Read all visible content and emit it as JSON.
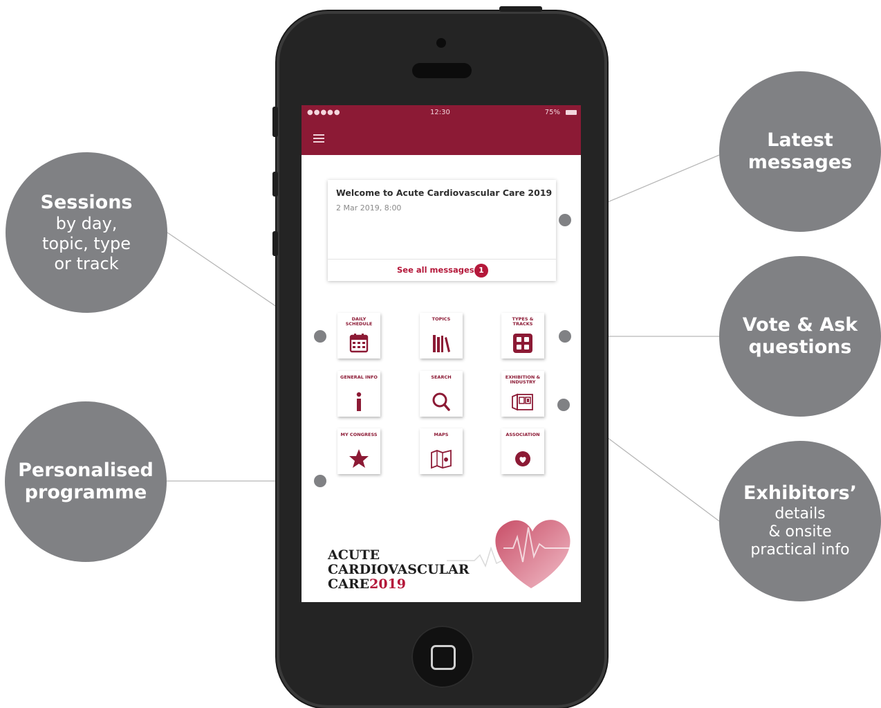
{
  "callouts": {
    "sessions": {
      "title": "Sessions",
      "lines": [
        "by day,",
        "topic, type",
        "or track"
      ]
    },
    "personal": {
      "title_line1": "Personalised",
      "title_line2": "programme"
    },
    "latest": {
      "title_line1": "Latest",
      "title_line2": "messages"
    },
    "vote": {
      "title_line1": "Vote & Ask",
      "title_line2": "questions"
    },
    "exhibitors": {
      "title": "Exhibitors’",
      "lines": [
        "details",
        "& onsite",
        "practical info"
      ]
    }
  },
  "status_bar": {
    "signal": "●●●●● ",
    "time": "12:30",
    "battery": "75%"
  },
  "message_card": {
    "title": "Welcome to Acute Cardiovascular Care 2019",
    "date": "2 Mar 2019, 8:00",
    "link": "See all messages",
    "badge": "1"
  },
  "tiles": [
    {
      "label": "DAILY SCHEDULE",
      "icon": "calendar-icon"
    },
    {
      "label": "TOPICS",
      "icon": "books-icon"
    },
    {
      "label": "TYPES & TRACKS",
      "icon": "grid-icon"
    },
    {
      "label": "GENERAL INFO",
      "icon": "info-icon"
    },
    {
      "label": "SEARCH",
      "icon": "search-icon"
    },
    {
      "label": "EXHIBITION & INDUSTRY",
      "icon": "booth-icon"
    },
    {
      "label": "MY CONGRESS",
      "icon": "star-icon"
    },
    {
      "label": "MAPS",
      "icon": "map-icon"
    },
    {
      "label": "ASSOCIATION",
      "icon": "association-icon"
    }
  ],
  "logo": {
    "line1": "ACUTE",
    "line2": "CARDIOVASCULAR",
    "line3_a": "CARE",
    "line3_b": "2019"
  },
  "colors": {
    "bubble": "#808184",
    "brand": "#8c1a35",
    "accent": "#b4183a",
    "phone": "#242424"
  }
}
